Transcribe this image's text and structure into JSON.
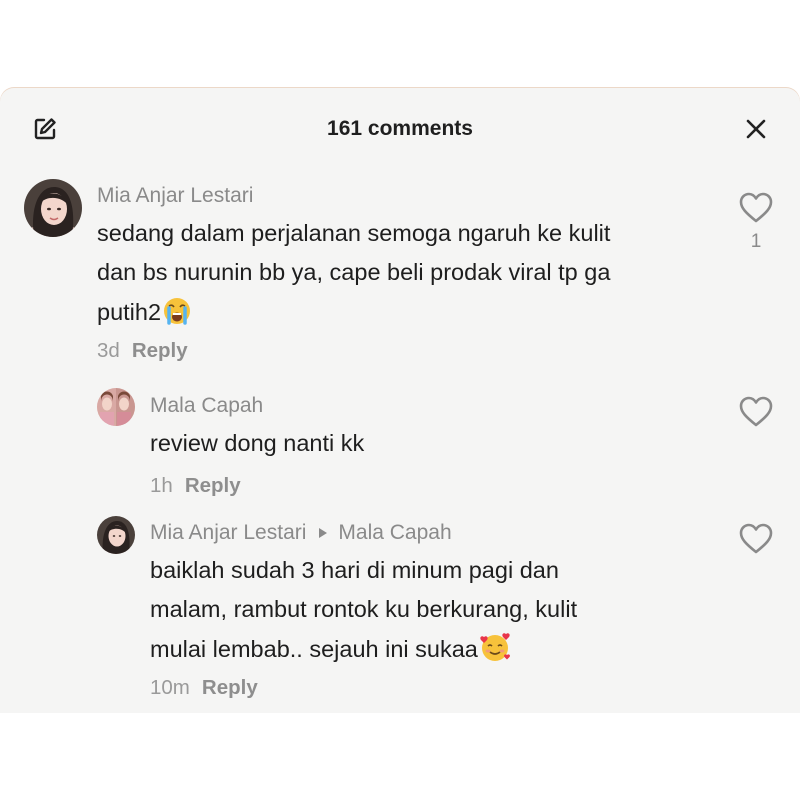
{
  "header": {
    "title": "161 comments",
    "edit_icon": "edit-icon",
    "close_icon": "close-icon"
  },
  "comments": [
    {
      "author": "Mia Anjar Lestari",
      "lines": [
        "sedang dalam perjalanan semoga ngaruh ke kulit",
        "dan bs nurunin bb ya, cape beli prodak viral tp ga",
        "putih2"
      ],
      "emoji": "loudly-crying-face",
      "time": "3d",
      "reply_label": "Reply",
      "likes": "1",
      "like_icon": "heart-icon"
    },
    {
      "author": "Mala Capah",
      "lines": [
        "review dong nanti kk"
      ],
      "time": "1h",
      "reply_label": "Reply",
      "like_icon": "heart-icon"
    },
    {
      "author": "Mia Anjar Lestari",
      "reply_to": "Mala Capah",
      "lines": [
        "baiklah sudah 3 hari di minum pagi dan",
        "malam, rambut rontok ku berkurang, kulit",
        "mulai lembab.. sejauh ini sukaa"
      ],
      "emoji": "smiling-face-with-hearts",
      "time": "10m",
      "reply_label": "Reply",
      "like_icon": "heart-icon"
    }
  ]
}
